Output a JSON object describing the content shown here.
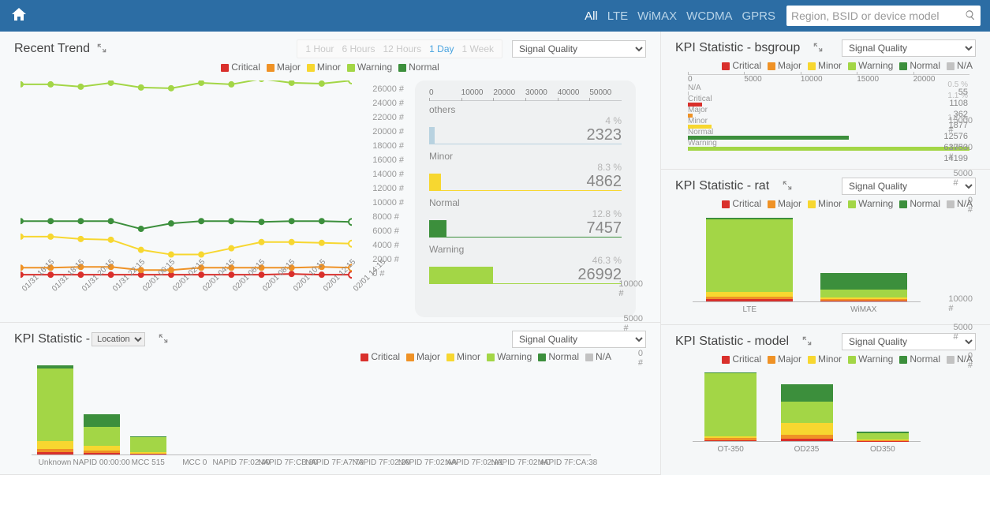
{
  "topbar": {
    "search_placeholder": "Region, BSID or device model",
    "tabs": [
      "All",
      "LTE",
      "WiMAX",
      "WCDMA",
      "GPRS"
    ],
    "active_tab": 0
  },
  "colors": {
    "critical": "#d9302c",
    "major": "#ef9226",
    "minor": "#f7d730",
    "warning": "#a3d646",
    "normal": "#3c8f3c",
    "na": "#c2c2c2",
    "others": "#b8d2e0"
  },
  "legend_full": [
    "Critical",
    "Major",
    "Minor",
    "Warning",
    "Normal",
    "N/A"
  ],
  "legend_trend": [
    "Critical",
    "Major",
    "Minor",
    "Warning",
    "Normal"
  ],
  "kpi_options": [
    "Signal Quality"
  ],
  "trend": {
    "title": "Recent Trend",
    "time_tabs": [
      "1 Hour",
      "6 Hours",
      "12 Hours",
      "1 Day",
      "1 Week"
    ],
    "time_active": 3,
    "kpi_selected": "Signal Quality"
  },
  "side_bars": {
    "scale": [
      0,
      10000,
      20000,
      30000,
      40000,
      50000
    ],
    "rows": [
      {
        "label": "others",
        "pct": "4 %",
        "value": 2323,
        "color": "others"
      },
      {
        "label": "Minor",
        "pct": "8.3 %",
        "value": 4862,
        "color": "minor"
      },
      {
        "label": "Normal",
        "pct": "12.8 %",
        "value": 7457,
        "color": "normal"
      },
      {
        "label": "Warning",
        "pct": "46.3 %",
        "value": 26992,
        "color": "warning"
      }
    ]
  },
  "location_panel": {
    "title_prefix": "KPI Statistic - ",
    "select_value": "Location",
    "kpi_selected": "Signal Quality"
  },
  "bsgroup_panel": {
    "title": "KPI Statistic - bsgroup",
    "kpi_selected": "Signal Quality"
  },
  "rat_panel": {
    "title": "KPI Statistic - rat",
    "kpi_selected": "Signal Quality"
  },
  "model_panel": {
    "title": "KPI Statistic - model",
    "kpi_selected": "Signal Quality"
  },
  "chart_data": [
    {
      "id": "trend_line",
      "type": "line",
      "x": [
        "01/31 16:15",
        "01/31 18:15",
        "01/31 20:15",
        "01/31 22:15",
        "02/01 00:15",
        "02/01 02:15",
        "02/01 04:15",
        "02/01 06:15",
        "02/01 08:15",
        "02/01 10:15",
        "02/01 12:15",
        "02/01 14:15"
      ],
      "ylim": [
        0,
        26000
      ],
      "y_ticks": [
        0,
        2000,
        4000,
        6000,
        8000,
        10000,
        12000,
        14000,
        16000,
        18000,
        20000,
        22000,
        24000,
        26000
      ],
      "series": [
        {
          "name": "Critical",
          "color": "critical",
          "values": [
            1000,
            1000,
            1000,
            1000,
            1000,
            1000,
            1000,
            1000,
            1000,
            1100,
            1000,
            1000
          ]
        },
        {
          "name": "Major",
          "color": "major",
          "values": [
            1900,
            1900,
            2000,
            2000,
            1600,
            1600,
            1900,
            1900,
            1900,
            1900,
            2000,
            1900
          ]
        },
        {
          "name": "Minor",
          "color": "minor",
          "values": [
            5900,
            5900,
            5600,
            5500,
            4200,
            3600,
            3600,
            4400,
            5200,
            5200,
            5100,
            5000
          ]
        },
        {
          "name": "Warning",
          "color": "warning",
          "values": [
            25500,
            25500,
            25200,
            25700,
            25100,
            25000,
            25700,
            25500,
            26200,
            25700,
            25600,
            26000
          ]
        },
        {
          "name": "Normal",
          "color": "normal",
          "values": [
            7900,
            7900,
            7900,
            7900,
            6900,
            7600,
            7900,
            7900,
            7800,
            7900,
            7900,
            7800
          ]
        }
      ]
    },
    {
      "id": "side_bars",
      "type": "bar",
      "orientation": "horizontal",
      "xlim": [
        0,
        50000
      ],
      "categories": [
        "others",
        "Minor",
        "Normal",
        "Warning"
      ],
      "values": [
        2323,
        4862,
        7457,
        26992
      ],
      "colors": [
        "others",
        "minor",
        "normal",
        "warning"
      ],
      "percents": [
        "4 %",
        "8.3 %",
        "12.8 %",
        "46.3 %"
      ]
    },
    {
      "id": "location_stacked",
      "type": "bar",
      "stacked": true,
      "ylim": [
        0,
        13000
      ],
      "y_ticks": [
        0,
        5000,
        10000
      ],
      "categories": [
        "Unknown",
        "NAPID 00:00:00",
        "MCC 515",
        "MCC 0",
        "NAPID 7F:02:40",
        "NAPID 7F:CB:80",
        "NAPID 7F:A7:70",
        "NAPID 7F:02:20",
        "NAPID 7F:02:AA",
        "NAPID 7F:02:A1",
        "NAPID 7F:02:AC",
        "NAPID 7F:CA:38"
      ],
      "series": [
        {
          "name": "Critical",
          "color": "critical",
          "values": [
            350,
            250,
            80,
            0,
            0,
            0,
            0,
            0,
            0,
            0,
            0,
            0
          ]
        },
        {
          "name": "Major",
          "color": "major",
          "values": [
            400,
            300,
            80,
            0,
            0,
            0,
            0,
            0,
            0,
            0,
            0,
            0
          ]
        },
        {
          "name": "Minor",
          "color": "minor",
          "values": [
            1200,
            700,
            200,
            0,
            0,
            0,
            0,
            0,
            0,
            0,
            0,
            0
          ]
        },
        {
          "name": "Warning",
          "color": "warning",
          "values": [
            10500,
            2800,
            2200,
            0,
            0,
            0,
            0,
            0,
            0,
            0,
            0,
            0
          ]
        },
        {
          "name": "Normal",
          "color": "normal",
          "values": [
            400,
            1800,
            100,
            0,
            0,
            0,
            0,
            0,
            0,
            0,
            0,
            0
          ]
        },
        {
          "name": "N/A",
          "color": "na",
          "values": [
            0,
            0,
            0,
            0,
            0,
            0,
            0,
            0,
            0,
            0,
            0,
            0
          ]
        }
      ]
    },
    {
      "id": "bsgroup_hbar",
      "type": "bar",
      "orientation": "horizontal",
      "xlim": [
        0,
        22000
      ],
      "x_ticks": [
        0,
        5000,
        10000,
        15000,
        20000
      ],
      "rows": [
        {
          "label": "N/A",
          "color": "na",
          "value": 55,
          "pct": "0.5 %"
        },
        {
          "label": "Critical",
          "color": "critical",
          "value": 1108,
          "pct": "1.1 %"
        },
        {
          "label": "Major",
          "color": "major",
          "value": 362,
          "pct": ""
        },
        {
          "label": "Minor",
          "color": "minor",
          "value": 1877,
          "pct": "1.1 %"
        },
        {
          "label": "Normal",
          "color": "normal",
          "value": 12576,
          "pct": ""
        },
        {
          "label": "Warning",
          "color": "warning",
          "value": 63753,
          "pct": ""
        }
      ],
      "tail_value": 14199
    },
    {
      "id": "rat_stacked",
      "type": "bar",
      "stacked": true,
      "ylim": [
        0,
        17000
      ],
      "y_ticks": [
        0,
        5000,
        10000,
        15000
      ],
      "categories": [
        "LTE",
        "WiMAX"
      ],
      "series": [
        {
          "name": "Critical",
          "color": "critical",
          "values": [
            450,
            150
          ]
        },
        {
          "name": "Major",
          "color": "major",
          "values": [
            500,
            300
          ]
        },
        {
          "name": "Minor",
          "color": "minor",
          "values": [
            900,
            250
          ]
        },
        {
          "name": "Warning",
          "color": "warning",
          "values": [
            13600,
            1500
          ]
        },
        {
          "name": "Normal",
          "color": "normal",
          "values": [
            350,
            3200
          ]
        },
        {
          "name": "N/A",
          "color": "na",
          "values": [
            0,
            0
          ]
        }
      ]
    },
    {
      "id": "model_stacked",
      "type": "bar",
      "stacked": true,
      "ylim": [
        0,
        13000
      ],
      "y_ticks": [
        0,
        5000,
        10000
      ],
      "categories": [
        "OT-350",
        "OD235",
        "OD350"
      ],
      "series": [
        {
          "name": "Critical",
          "color": "critical",
          "values": [
            200,
            350,
            50
          ]
        },
        {
          "name": "Major",
          "color": "major",
          "values": [
            300,
            700,
            100
          ]
        },
        {
          "name": "Minor",
          "color": "minor",
          "values": [
            400,
            2200,
            100
          ]
        },
        {
          "name": "Warning",
          "color": "warning",
          "values": [
            11000,
            3700,
            1200
          ]
        },
        {
          "name": "Normal",
          "color": "normal",
          "values": [
            200,
            3000,
            150
          ]
        },
        {
          "name": "N/A",
          "color": "na",
          "values": [
            0,
            0,
            0
          ]
        }
      ]
    }
  ]
}
